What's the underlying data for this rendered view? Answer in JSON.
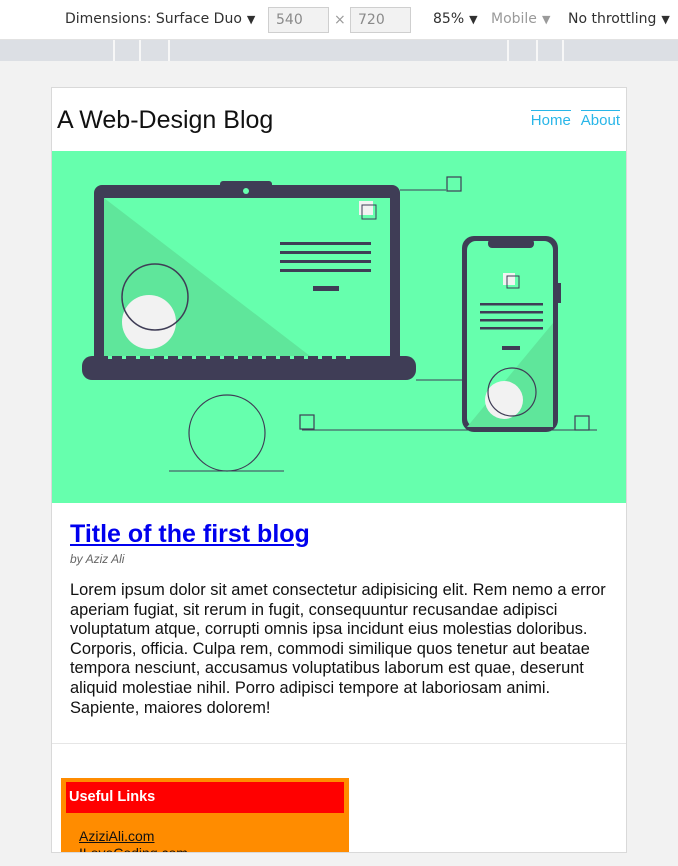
{
  "devtools": {
    "dimensions_label": "Dimensions: Surface Duo",
    "width_value": "540",
    "times_sign": "×",
    "height_value": "720",
    "zoom": "85%",
    "mobile": "Mobile",
    "throttling": "No throttling",
    "arrow": "▼"
  },
  "page": {
    "brand": "A Web-Design Blog",
    "nav": [
      {
        "label": "Home"
      },
      {
        "label": "About"
      }
    ],
    "hero_colors": {
      "background": "#66ffad",
      "device": "#3f3d56",
      "screen_accent": "#5fe69b",
      "circle": "#f2f2f2"
    },
    "post": {
      "title": "Title of the first blog",
      "author": "by Aziz Ali",
      "body": "Lorem ipsum dolor sit amet consectetur adipisicing elit. Rem nemo a error aperiam fugiat, sit rerum in fugit, consequuntur recusandae adipisci voluptatum atque, corrupti omnis ipsa incidunt eius molestias doloribus. Corporis, officia. Culpa rem, commodi similique quos tenetur aut beatae tempora nesciunt, accusamus voluptatibus laborum est quae, deserunt aliquid molestiae nihil. Porro adipisci tempore at laboriosam animi. Sapiente, maiores dolorem!"
    },
    "useful_links": {
      "heading": "Useful Links",
      "items": [
        {
          "label": "AziziAli.com"
        },
        {
          "label": "ILoveCoding.com"
        }
      ]
    }
  }
}
